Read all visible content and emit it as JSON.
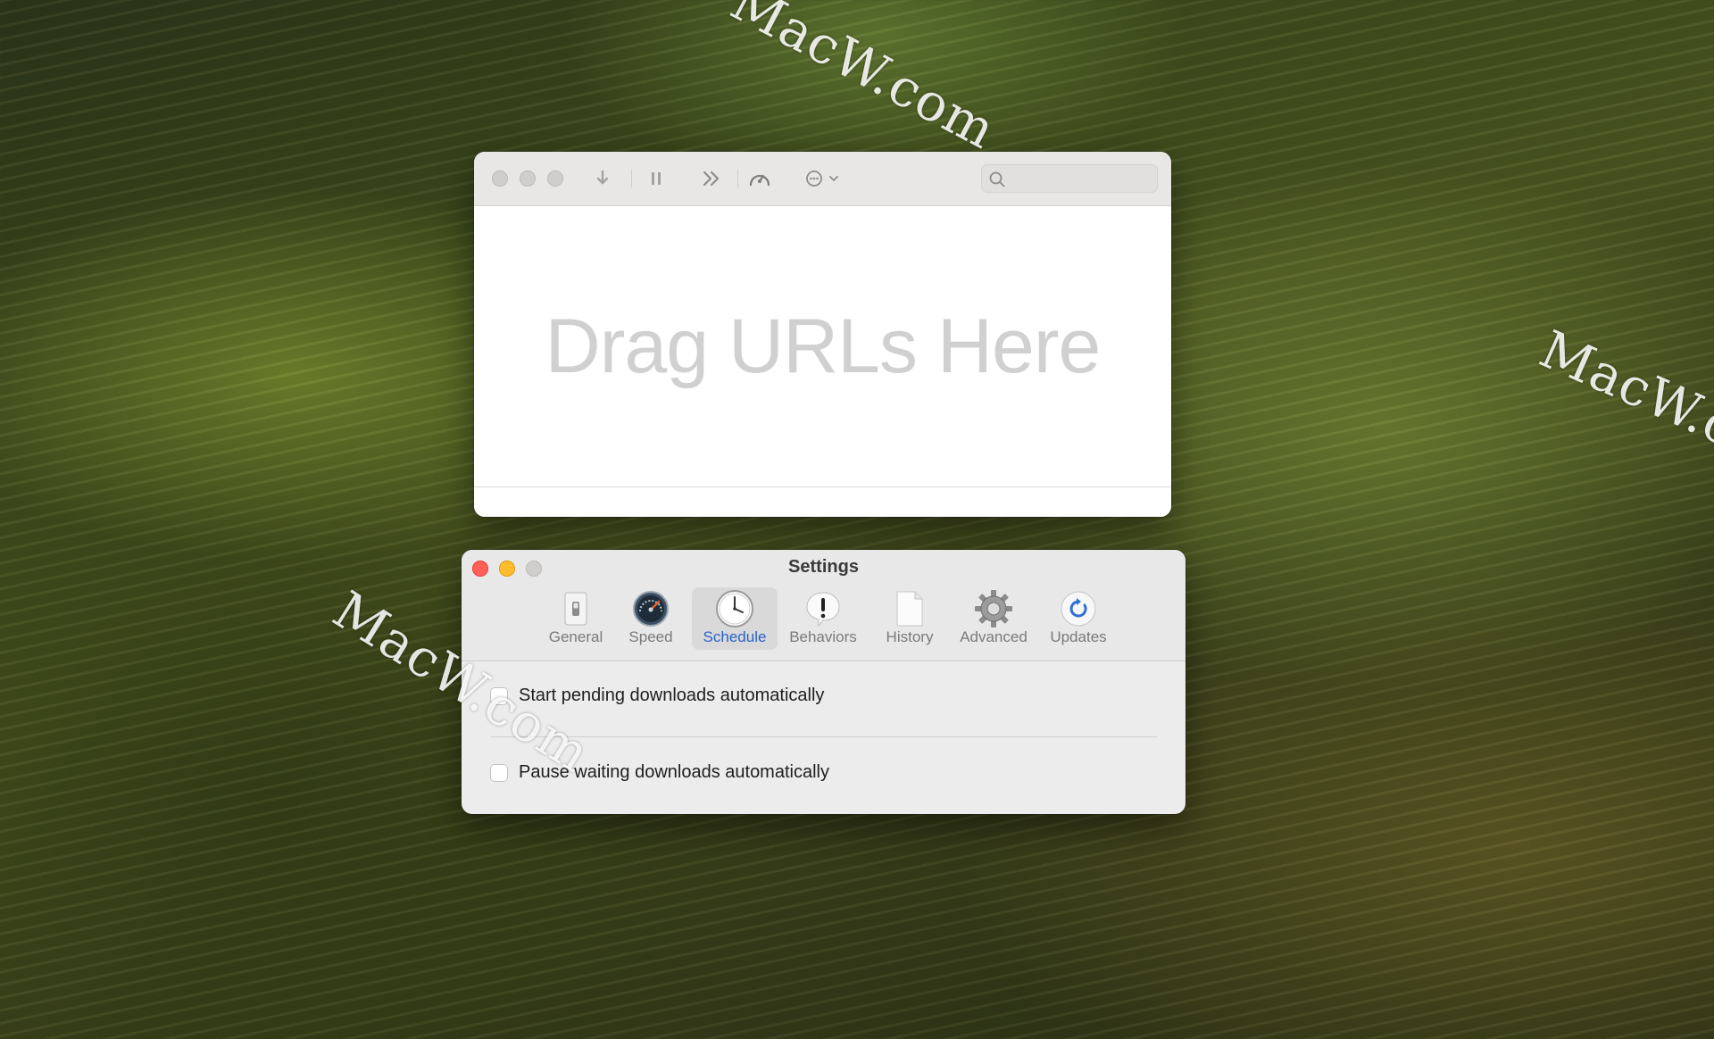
{
  "watermark": {
    "text": "MacW.com"
  },
  "main_window": {
    "drop_hint": "Drag URLs Here",
    "toolbar": {
      "icons": [
        "download-icon",
        "pause-icon",
        "fast-forward-icon",
        "speedometer-icon",
        "more-icon",
        "chevron-down-icon"
      ],
      "search": {
        "placeholder": ""
      }
    }
  },
  "settings": {
    "title": "Settings",
    "tabs": [
      {
        "label": "General",
        "icon": "switch-icon"
      },
      {
        "label": "Speed",
        "icon": "speedometer-icon"
      },
      {
        "label": "Schedule",
        "icon": "clock-icon",
        "active": true
      },
      {
        "label": "Behaviors",
        "icon": "exclamation-bubble-icon"
      },
      {
        "label": "History",
        "icon": "document-icon"
      },
      {
        "label": "Advanced",
        "icon": "gear-icon"
      },
      {
        "label": "Updates",
        "icon": "refresh-icon"
      }
    ],
    "options": [
      {
        "label": "Start pending downloads automatically",
        "checked": false
      },
      {
        "label": "Pause waiting downloads automatically",
        "checked": false
      }
    ]
  },
  "colors": {
    "accent": "#2a63c8",
    "close": "#fe5f57",
    "minimize": "#febc2e"
  }
}
